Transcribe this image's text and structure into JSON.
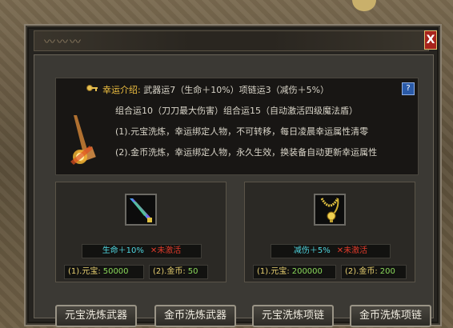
{
  "window": {
    "close_label": "X"
  },
  "info": {
    "title": "幸运介绍:",
    "line1_rest": "武器运7（生命＋10%）项链运3（减伤＋5%）",
    "line2": "组合运10（刀刀最大伤害）组合运15（自动激活四级魔法盾）",
    "line3": "(1).元宝洗炼，幸运绑定人物，不可转移，每日凌晨幸运属性清零",
    "line4": "(2).金币洗炼，幸运绑定人物，永久生效，换装备自动更新幸运属性",
    "help_label": "?"
  },
  "weapon_panel": {
    "stat": "生命＋10%",
    "status": "✕未激活",
    "ingot_label": "(1).元宝:",
    "ingot_value": "50000",
    "gold_label": "(2).金币:",
    "gold_value": "50"
  },
  "necklace_panel": {
    "stat": "减伤＋5%",
    "status": "✕未激活",
    "ingot_label": "(1).元宝:",
    "ingot_value": "200000",
    "gold_label": "(2).金币:",
    "gold_value": "200"
  },
  "buttons": {
    "ingot_weapon": "元宝洗炼武器",
    "gold_weapon": "金币洗炼武器",
    "ingot_necklace": "元宝洗炼项链",
    "gold_necklace": "金币洗炼项链"
  },
  "colors": {
    "title_gold": "#f0c040",
    "stat_cyan": "#4fd6e0",
    "inactive_red": "#e03a2a",
    "cost_value_green": "#8ad85a",
    "close_red": "#a8241c"
  }
}
